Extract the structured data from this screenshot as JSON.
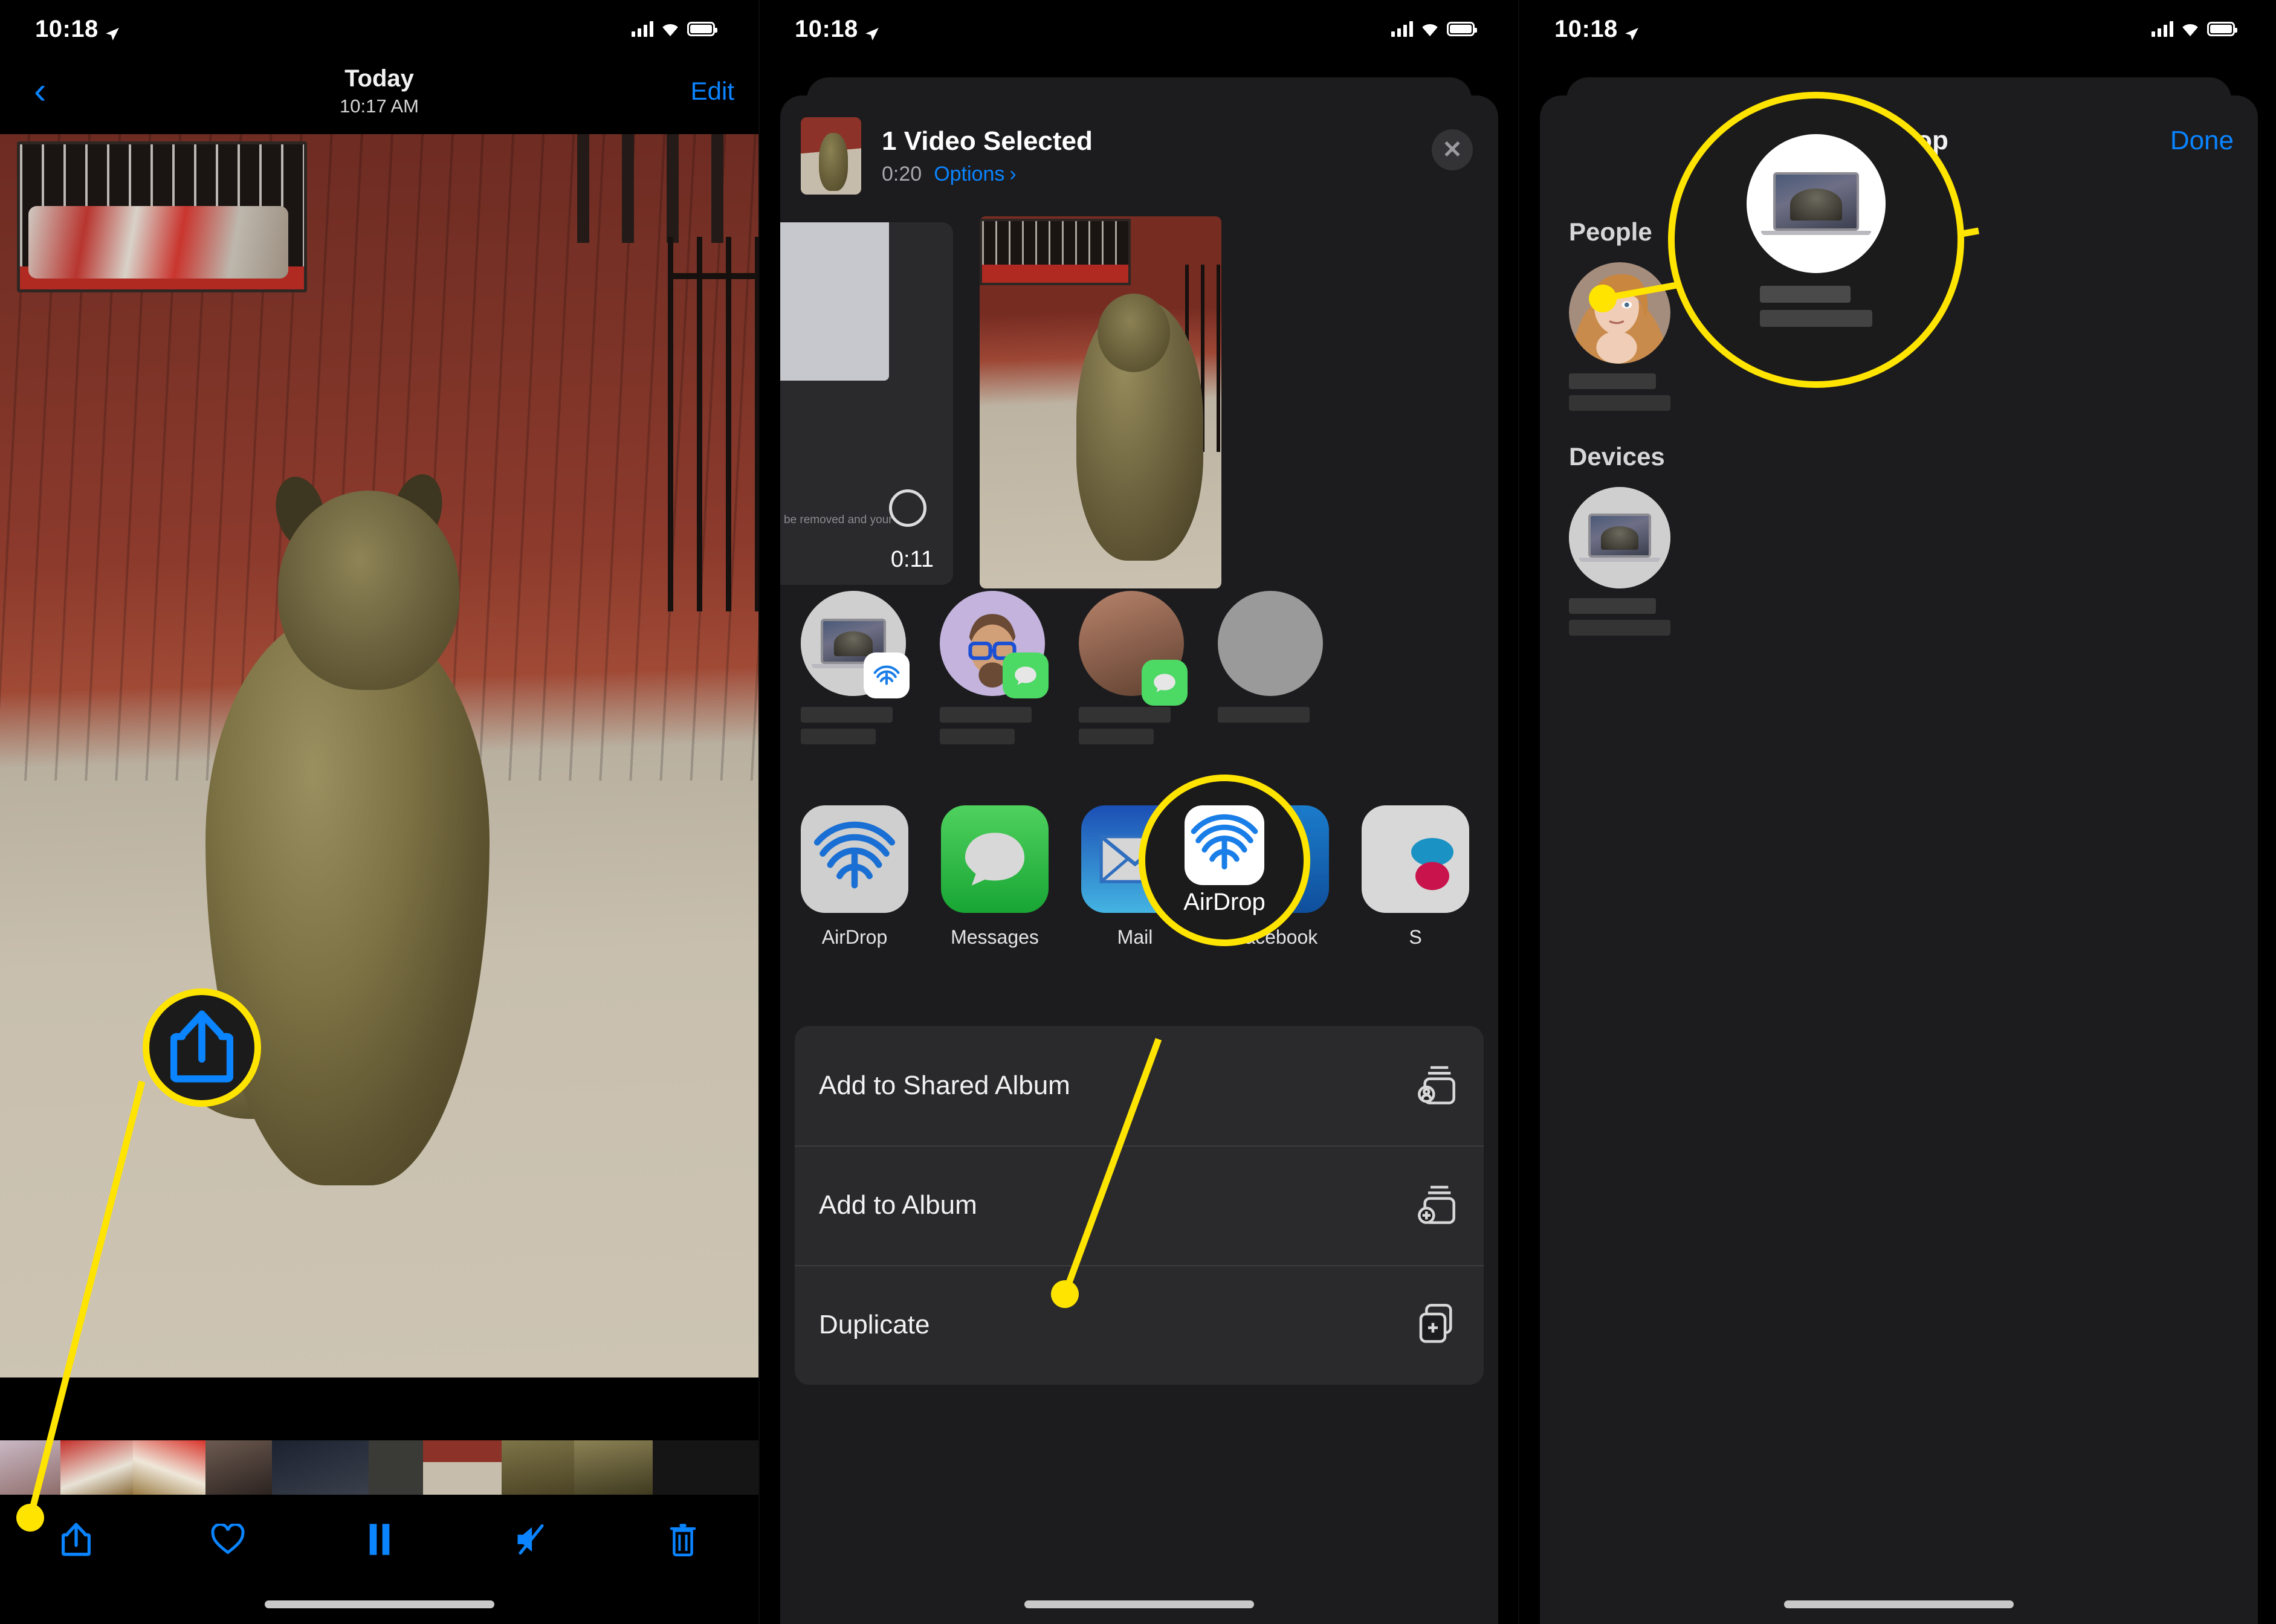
{
  "panel1": {
    "name": "photo-viewer",
    "status": {
      "time": "10:18",
      "location_icon": "location-arrow-icon",
      "signal_icon": "cellular-bars-icon",
      "wifi_icon": "wifi-icon",
      "battery_icon": "battery-icon"
    },
    "nav": {
      "back_icon": "chevron-left-icon",
      "title": "Today",
      "subtitle": "10:17 AM",
      "edit_label": "Edit"
    },
    "toolbar": [
      {
        "name": "share-button",
        "icon": "share-icon"
      },
      {
        "name": "favorite-button",
        "icon": "heart-icon"
      },
      {
        "name": "pause-button",
        "icon": "pause-icon"
      },
      {
        "name": "mute-button",
        "icon": "speaker-mute-icon"
      },
      {
        "name": "delete-button",
        "icon": "trash-icon"
      }
    ],
    "callout": {
      "icon": "share-icon",
      "color": "#ffe400"
    }
  },
  "panel2": {
    "name": "share-sheet",
    "status": {
      "time": "10:18",
      "location_icon": "location-arrow-icon"
    },
    "header": {
      "title": "1 Video Selected",
      "duration": "0:20",
      "options_label": "Options",
      "options_chevron": "chevron-right-icon",
      "close_icon": "close-icon"
    },
    "preview": {
      "clip_duration": "0:11",
      "caption": "be removed and your",
      "select_ring": "selection-circle-icon"
    },
    "people": [
      {
        "name": "person-macbook",
        "badge": "airdrop-icon",
        "badge_color": "#ffffff",
        "avatar_color": "#c8c8c8"
      },
      {
        "name": "person-memoji",
        "badge": "messages-icon",
        "badge_color": "#4cd964",
        "avatar_color": "#c3b3dd"
      },
      {
        "name": "person-photo",
        "badge": "messages-icon",
        "badge_color": "#4cd964",
        "avatar_color": "#7a5a48"
      },
      {
        "name": "person-partial",
        "badge": "",
        "badge_color": "",
        "avatar_color": "#9a9a9a"
      }
    ],
    "apps": [
      {
        "label": "AirDrop",
        "icon": "airdrop-icon",
        "bg": "#cfcfcf"
      },
      {
        "label": "Messages",
        "icon": "messages-icon",
        "bg": "#31c44b"
      },
      {
        "label": "Mail",
        "icon": "mail-icon",
        "bg": "#1d4fad"
      },
      {
        "label": "Facebook",
        "icon": "facebook-icon",
        "bg": "#1877c9"
      },
      {
        "label": "S",
        "icon": "flickr-icon",
        "bg": "#d8d8d8"
      }
    ],
    "actions": [
      {
        "label": "Add to Shared Album",
        "icon": "shared-album-icon"
      },
      {
        "label": "Add to Album",
        "icon": "add-album-icon"
      },
      {
        "label": "Duplicate",
        "icon": "duplicate-icon"
      }
    ],
    "callout": {
      "label": "AirDrop",
      "icon": "airdrop-icon",
      "color": "#ffe400"
    }
  },
  "panel3": {
    "name": "airdrop-picker",
    "status": {
      "time": "10:18",
      "location_icon": "location-arrow-icon"
    },
    "nav": {
      "title": "AirDrop",
      "done_label": "Done"
    },
    "sections": [
      {
        "heading": "People",
        "items": [
          {
            "name": "airdrop-person",
            "avatar": "portrait-photo"
          }
        ]
      },
      {
        "heading": "Devices",
        "items": [
          {
            "name": "airdrop-device-macbook",
            "avatar": "macbook-icon"
          }
        ]
      }
    ],
    "callout": {
      "icon": "macbook-icon",
      "color": "#ffe400"
    }
  }
}
